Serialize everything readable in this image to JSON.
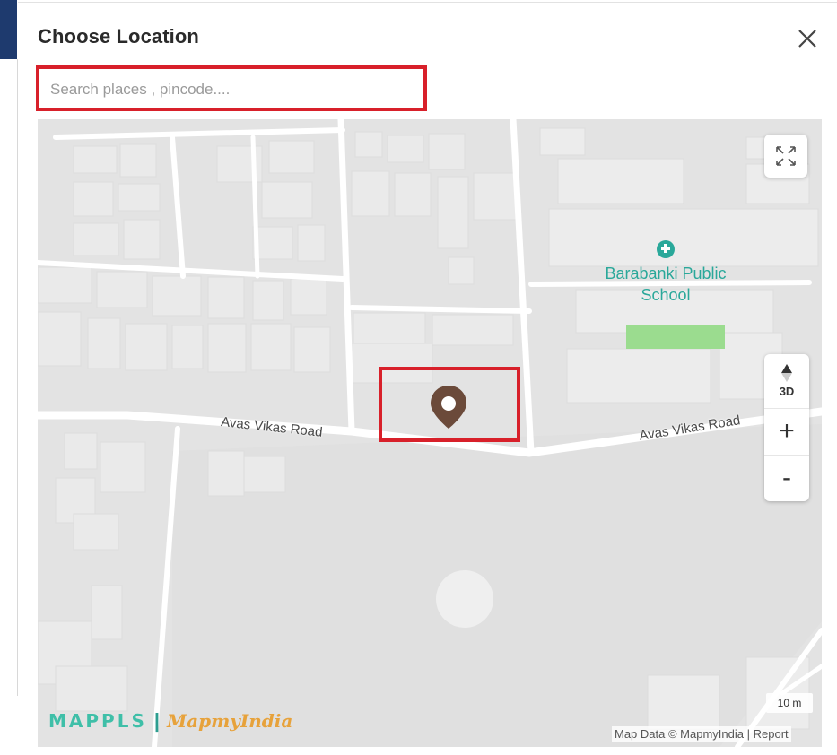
{
  "dialog": {
    "title": "Choose Location",
    "close_label": "Close"
  },
  "search": {
    "placeholder": "Search places , pincode....",
    "value": ""
  },
  "map": {
    "poi_name": "Barabanki Public School",
    "road_labels": [
      "Avas Vikas Road",
      "Avas Vikas Road"
    ],
    "controls": {
      "fullscreen_icon": "expand-arrows-icon",
      "three_d_label": "3D",
      "zoom_in_label": "+",
      "zoom_out_label": "-"
    },
    "scale_label": "10 m",
    "attribution": "Map Data © MapmyIndia",
    "attribution_separator": "|",
    "report_label": "Report",
    "logo": {
      "mappls": "MAPPLS",
      "separator": "|",
      "mapmyindia": "MapmyIndia"
    },
    "marker_icon": "location-pin-icon",
    "colors": {
      "marker": "#6b4a3a",
      "highlight_border": "#d8202a",
      "poi_text": "#2aa89a",
      "park": "#9bdc8f"
    }
  }
}
